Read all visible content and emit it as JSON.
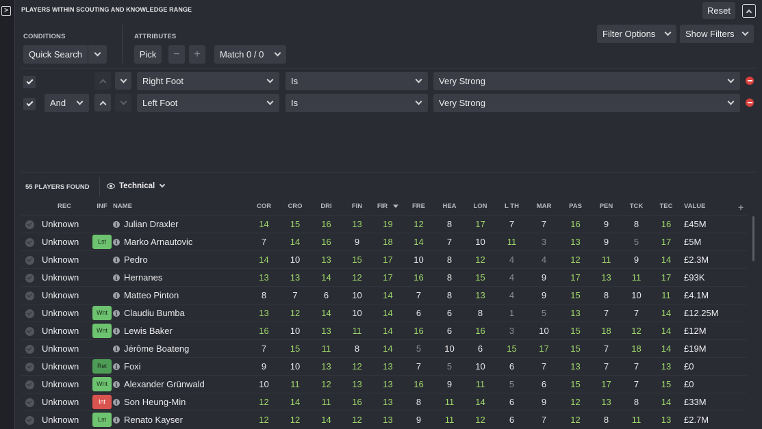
{
  "title": "PLAYERS WITHIN SCOUTING AND KNOWLEDGE RANGE",
  "reset_label": "Reset",
  "conditions": {
    "label": "CONDITIONS",
    "quick_search": "Quick Search"
  },
  "attributes": {
    "label": "ATTRIBUTES",
    "pick": "Pick",
    "minus": "−",
    "plus": "+",
    "match": "Match 0 / 0"
  },
  "filter_options": "Filter Options",
  "show_filters": "Show Filters",
  "filters": [
    {
      "connector": "",
      "attribute": "Right Foot",
      "operator": "Is",
      "value": "Very Strong"
    },
    {
      "connector": "And",
      "attribute": "Left Foot",
      "operator": "Is",
      "value": "Very Strong"
    }
  ],
  "results": {
    "count_label": "55 PLAYERS FOUND",
    "view": "Technical"
  },
  "columns": [
    "REC",
    "INF",
    "NAME",
    "COR",
    "CRO",
    "DRI",
    "FIN",
    "FIR",
    "FRE",
    "HEA",
    "LON",
    "L TH",
    "MAR",
    "PAS",
    "PEN",
    "TCK",
    "TEC",
    "VALUE"
  ],
  "add_column": "+",
  "info_glyph": "i",
  "colors": {
    "attr_high": "#9ed86a",
    "attr_mid": "#e8e8ea",
    "attr_low": "#8b8e96",
    "badge_green": "#6dc36f",
    "badge_red": "#d9534f"
  },
  "players": [
    {
      "rec": "Unknown",
      "inf": "",
      "name": "Julian Draxler",
      "attrs": [
        14,
        15,
        16,
        13,
        19,
        12,
        8,
        17,
        7,
        7,
        16,
        9,
        8,
        16
      ],
      "value": "£45M"
    },
    {
      "rec": "Unknown",
      "inf": "Lst",
      "name": "Marko Arnautovic",
      "attrs": [
        7,
        14,
        16,
        9,
        18,
        14,
        7,
        10,
        11,
        3,
        13,
        9,
        5,
        17
      ],
      "value": "£5M"
    },
    {
      "rec": "Unknown",
      "inf": "",
      "name": "Pedro",
      "attrs": [
        14,
        10,
        13,
        15,
        17,
        10,
        8,
        12,
        4,
        4,
        12,
        11,
        9,
        14
      ],
      "value": "£2.3M"
    },
    {
      "rec": "Unknown",
      "inf": "",
      "name": "Hernanes",
      "attrs": [
        13,
        13,
        14,
        12,
        17,
        16,
        8,
        15,
        4,
        9,
        17,
        13,
        11,
        17
      ],
      "value": "£93K"
    },
    {
      "rec": "Unknown",
      "inf": "",
      "name": "Matteo Pinton",
      "attrs": [
        8,
        7,
        6,
        10,
        14,
        7,
        8,
        13,
        4,
        9,
        15,
        8,
        10,
        11
      ],
      "value": "£4.1M"
    },
    {
      "rec": "Unknown",
      "inf": "Wnt",
      "name": "Claudiu Bumba",
      "attrs": [
        13,
        12,
        14,
        10,
        14,
        6,
        6,
        8,
        1,
        5,
        13,
        7,
        7,
        14
      ],
      "value": "£12.25M"
    },
    {
      "rec": "Unknown",
      "inf": "Wnt",
      "name": "Lewis Baker",
      "attrs": [
        16,
        10,
        13,
        11,
        14,
        16,
        6,
        16,
        3,
        10,
        15,
        18,
        12,
        14
      ],
      "value": "£12M"
    },
    {
      "rec": "Unknown",
      "inf": "",
      "name": "Jérôme Boateng",
      "attrs": [
        7,
        15,
        11,
        8,
        14,
        5,
        10,
        6,
        15,
        17,
        15,
        7,
        18,
        14
      ],
      "value": "£19M"
    },
    {
      "rec": "Unknown",
      "inf": "Ret",
      "name": "Foxi",
      "attrs": [
        9,
        10,
        13,
        12,
        13,
        7,
        5,
        10,
        6,
        7,
        13,
        7,
        7,
        13
      ],
      "value": "£0"
    },
    {
      "rec": "Unknown",
      "inf": "Wnt",
      "name": "Alexander Grünwald",
      "attrs": [
        10,
        11,
        12,
        13,
        13,
        16,
        9,
        11,
        5,
        6,
        15,
        17,
        7,
        15
      ],
      "value": "£0"
    },
    {
      "rec": "Unknown",
      "inf": "Int",
      "name": "Son Heung-Min",
      "attrs": [
        12,
        14,
        11,
        16,
        13,
        8,
        11,
        14,
        6,
        9,
        12,
        13,
        8,
        14
      ],
      "value": "£33M"
    },
    {
      "rec": "Unknown",
      "inf": "Lst",
      "name": "Renato Kayser",
      "attrs": [
        12,
        12,
        14,
        12,
        13,
        9,
        11,
        12,
        6,
        7,
        12,
        8,
        11,
        13
      ],
      "value": "£2.7M"
    }
  ]
}
